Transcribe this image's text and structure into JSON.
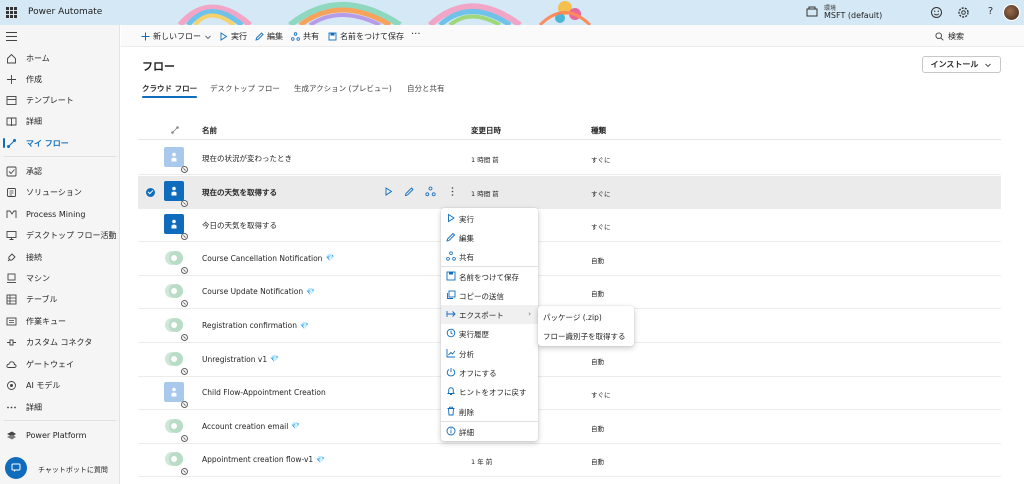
{
  "header": {
    "app_name": "Power Automate",
    "env_label": "環境",
    "env_name": "MSFT (default)"
  },
  "nav": {
    "items": [
      {
        "label": "ホーム",
        "icon": "home-icon"
      },
      {
        "label": "作成",
        "icon": "plus-icon"
      },
      {
        "label": "テンプレート",
        "icon": "template-icon"
      },
      {
        "label": "詳細",
        "icon": "book-icon"
      },
      {
        "label": "マイ フロー",
        "icon": "flow-icon",
        "active": true
      },
      {
        "label": "承認",
        "icon": "approval-icon"
      },
      {
        "label": "ソリューション",
        "icon": "solution-icon"
      },
      {
        "label": "Process Mining",
        "icon": "process-mining-icon"
      },
      {
        "label": "デスクトップ フロー活動",
        "icon": "desktop-flow-icon"
      },
      {
        "label": "接続",
        "icon": "plug-icon"
      },
      {
        "label": "マシン",
        "icon": "machine-icon"
      },
      {
        "label": "テーブル",
        "icon": "table-icon"
      },
      {
        "label": "作業キュー",
        "icon": "queue-icon"
      },
      {
        "label": "カスタム コネクタ",
        "icon": "connector-icon"
      },
      {
        "label": "ゲートウェイ",
        "icon": "cloud-icon"
      },
      {
        "label": "AI モデル",
        "icon": "ai-icon"
      },
      {
        "label": "詳細",
        "icon": "more-icon"
      },
      {
        "label": "Power Platform",
        "icon": "power-platform-icon"
      }
    ],
    "chatbot_label": "チャットボットに質問"
  },
  "cmdbar": {
    "new_flow": "新しいフロー",
    "run": "実行",
    "edit": "編集",
    "share": "共有",
    "save_as": "名前をつけて保存",
    "more": "···",
    "search": "検索"
  },
  "page": {
    "title": "フロー",
    "install_button": "インストール",
    "tabs": [
      "クラウド フロー",
      "デスクトップ フロー",
      "生成アクション (プレビュー)",
      "自分と共有"
    ]
  },
  "table": {
    "columns": {
      "name": "名前",
      "modified": "変更日時",
      "type": "種類"
    },
    "rows": [
      {
        "name": "現在の状況が変わったとき",
        "modified": "1 時間 前",
        "type": "すぐに",
        "thumb": "lightblue",
        "premium": false
      },
      {
        "name": "現在の天気を取得する",
        "modified": "1 時間 前",
        "type": "すぐに",
        "thumb": "blue",
        "premium": false,
        "selected": true
      },
      {
        "name": "今日の天気を取得する",
        "modified": "",
        "type": "すぐに",
        "thumb": "blue",
        "premium": false
      },
      {
        "name": "Course Cancellation Notification",
        "modified": "",
        "type": "自動",
        "thumb": "green",
        "premium": true
      },
      {
        "name": "Course Update Notification",
        "modified": "",
        "type": "自動",
        "thumb": "green",
        "premium": true
      },
      {
        "name": "Registration confirmation",
        "modified": "",
        "type": "",
        "thumb": "green",
        "premium": true
      },
      {
        "name": "Unregistration v1",
        "modified": "",
        "type": "自動",
        "thumb": "green",
        "premium": true
      },
      {
        "name": "Child Flow-Appointment Creation",
        "modified": "",
        "type": "すぐに",
        "thumb": "lightblue",
        "premium": false
      },
      {
        "name": "Account creation email",
        "modified": "",
        "type": "自動",
        "thumb": "green",
        "premium": true
      },
      {
        "name": "Appointment creation flow-v1",
        "modified": "1 年 前",
        "type": "自動",
        "thumb": "green",
        "premium": true
      }
    ]
  },
  "context_menu": {
    "items": [
      {
        "label": "実行",
        "icon": "play-icon"
      },
      {
        "label": "編集",
        "icon": "pencil-icon"
      },
      {
        "label": "共有",
        "icon": "share-icon"
      },
      {
        "label": "名前をつけて保存",
        "icon": "save-as-icon"
      },
      {
        "label": "コピーの送信",
        "icon": "copy-icon"
      },
      {
        "label": "エクスポート",
        "icon": "export-icon",
        "hover": true,
        "submenu": true
      },
      {
        "label": "実行履歴",
        "icon": "history-icon"
      },
      {
        "label": "分析",
        "icon": "analytics-icon"
      },
      {
        "label": "オフにする",
        "icon": "power-icon"
      },
      {
        "label": "ヒントをオフに戻す",
        "icon": "bell-icon"
      },
      {
        "label": "削除",
        "icon": "trash-icon"
      },
      {
        "label": "詳細",
        "icon": "info-icon"
      }
    ],
    "export_submenu": [
      "パッケージ (.zip)",
      "フロー識別子を取得する"
    ]
  },
  "colors": {
    "accent": "#0f6cbd",
    "header_bg": "#d4e8f6",
    "nav_bg": "#f5f5f5",
    "selected_row": "#ebebeb"
  }
}
